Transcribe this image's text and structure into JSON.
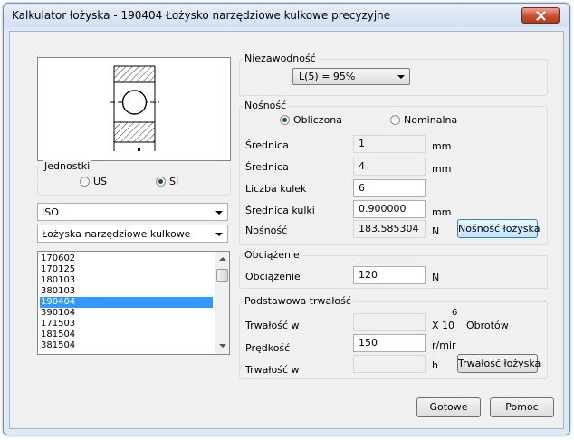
{
  "window": {
    "title": "Kalkulator łożyska - 190404 Łożysko narzędziowe kulkowe precyzyjne"
  },
  "units": {
    "label": "Jednostki",
    "us": "US",
    "si": "SI",
    "selected": "SI"
  },
  "standard": {
    "value": "ISO"
  },
  "bearing_type": {
    "value": "Łożyska narzędziowe kulkowe"
  },
  "bearing_list": {
    "items": [
      "170602",
      "170125",
      "180103",
      "380103",
      "190404",
      "390104",
      "171503",
      "181504",
      "381504"
    ],
    "selected": "190404"
  },
  "reliability": {
    "label": "Niezawodność",
    "value": "L(5) = 95%"
  },
  "capacity": {
    "label": "Nośność",
    "calculated": "Obliczona",
    "nominal": "Nominalna",
    "selected": "Obliczona",
    "rows": [
      {
        "label": "Średnica",
        "value": "1",
        "unit": "mm"
      },
      {
        "label": "Średnica",
        "value": "4",
        "unit": "mm"
      },
      {
        "label": "Liczba kulek",
        "value": "6",
        "unit": ""
      },
      {
        "label": "Średnica kulki",
        "value": "0.900000",
        "unit": "mm"
      },
      {
        "label": "Nośność",
        "value": "183.585304",
        "unit": "N"
      }
    ],
    "button": "Nośność łożyska"
  },
  "load": {
    "label": "Obciążenie",
    "field_label": "Obciążenie",
    "value": "120",
    "unit": "N"
  },
  "life": {
    "label": "Podstawowa trwałość",
    "life_label": "Trwałość w",
    "life_unit_base": "X 10",
    "life_unit_exp": "6",
    "life_unit_word": "Obrotów",
    "speed_label": "Prędkość",
    "speed_value": "150",
    "speed_unit": "r/mir",
    "life_hours_label": "Trwałość w",
    "life_hours_unit": "h",
    "button": "Trwałość łożyska"
  },
  "footer": {
    "ok": "Gotowe",
    "help": "Pomoc"
  }
}
